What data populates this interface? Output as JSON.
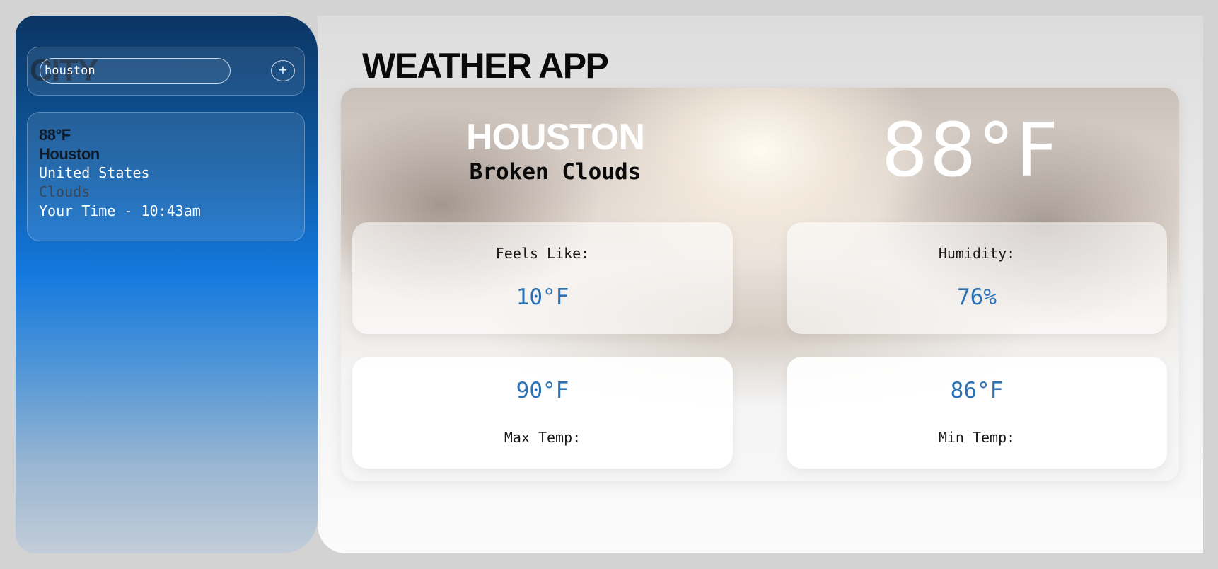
{
  "sidebar": {
    "city_label": "CITY",
    "search": {
      "value": "houston"
    },
    "add_button_label": "+",
    "summary": {
      "temp": "88°F",
      "city": "Houston",
      "country": "United States",
      "condition": "Clouds",
      "time": "Your Time - 10:43am"
    }
  },
  "main": {
    "app_title": "WEATHER APP",
    "city": "HOUSTON",
    "description": "Broken Clouds",
    "temperature": "88°F",
    "stats": {
      "feels_like": {
        "label": "Feels Like:",
        "value": "10°F"
      },
      "humidity": {
        "label": "Humidity:",
        "value": "76%"
      },
      "max_temp": {
        "label": "Max Temp:",
        "value": "90°F"
      },
      "min_temp": {
        "label": "Min Temp:",
        "value": "86°F"
      }
    }
  },
  "colors": {
    "stat_value": "#2a72b5",
    "sidebar_top": "#0b3563",
    "sidebar_mid": "#1479de"
  }
}
